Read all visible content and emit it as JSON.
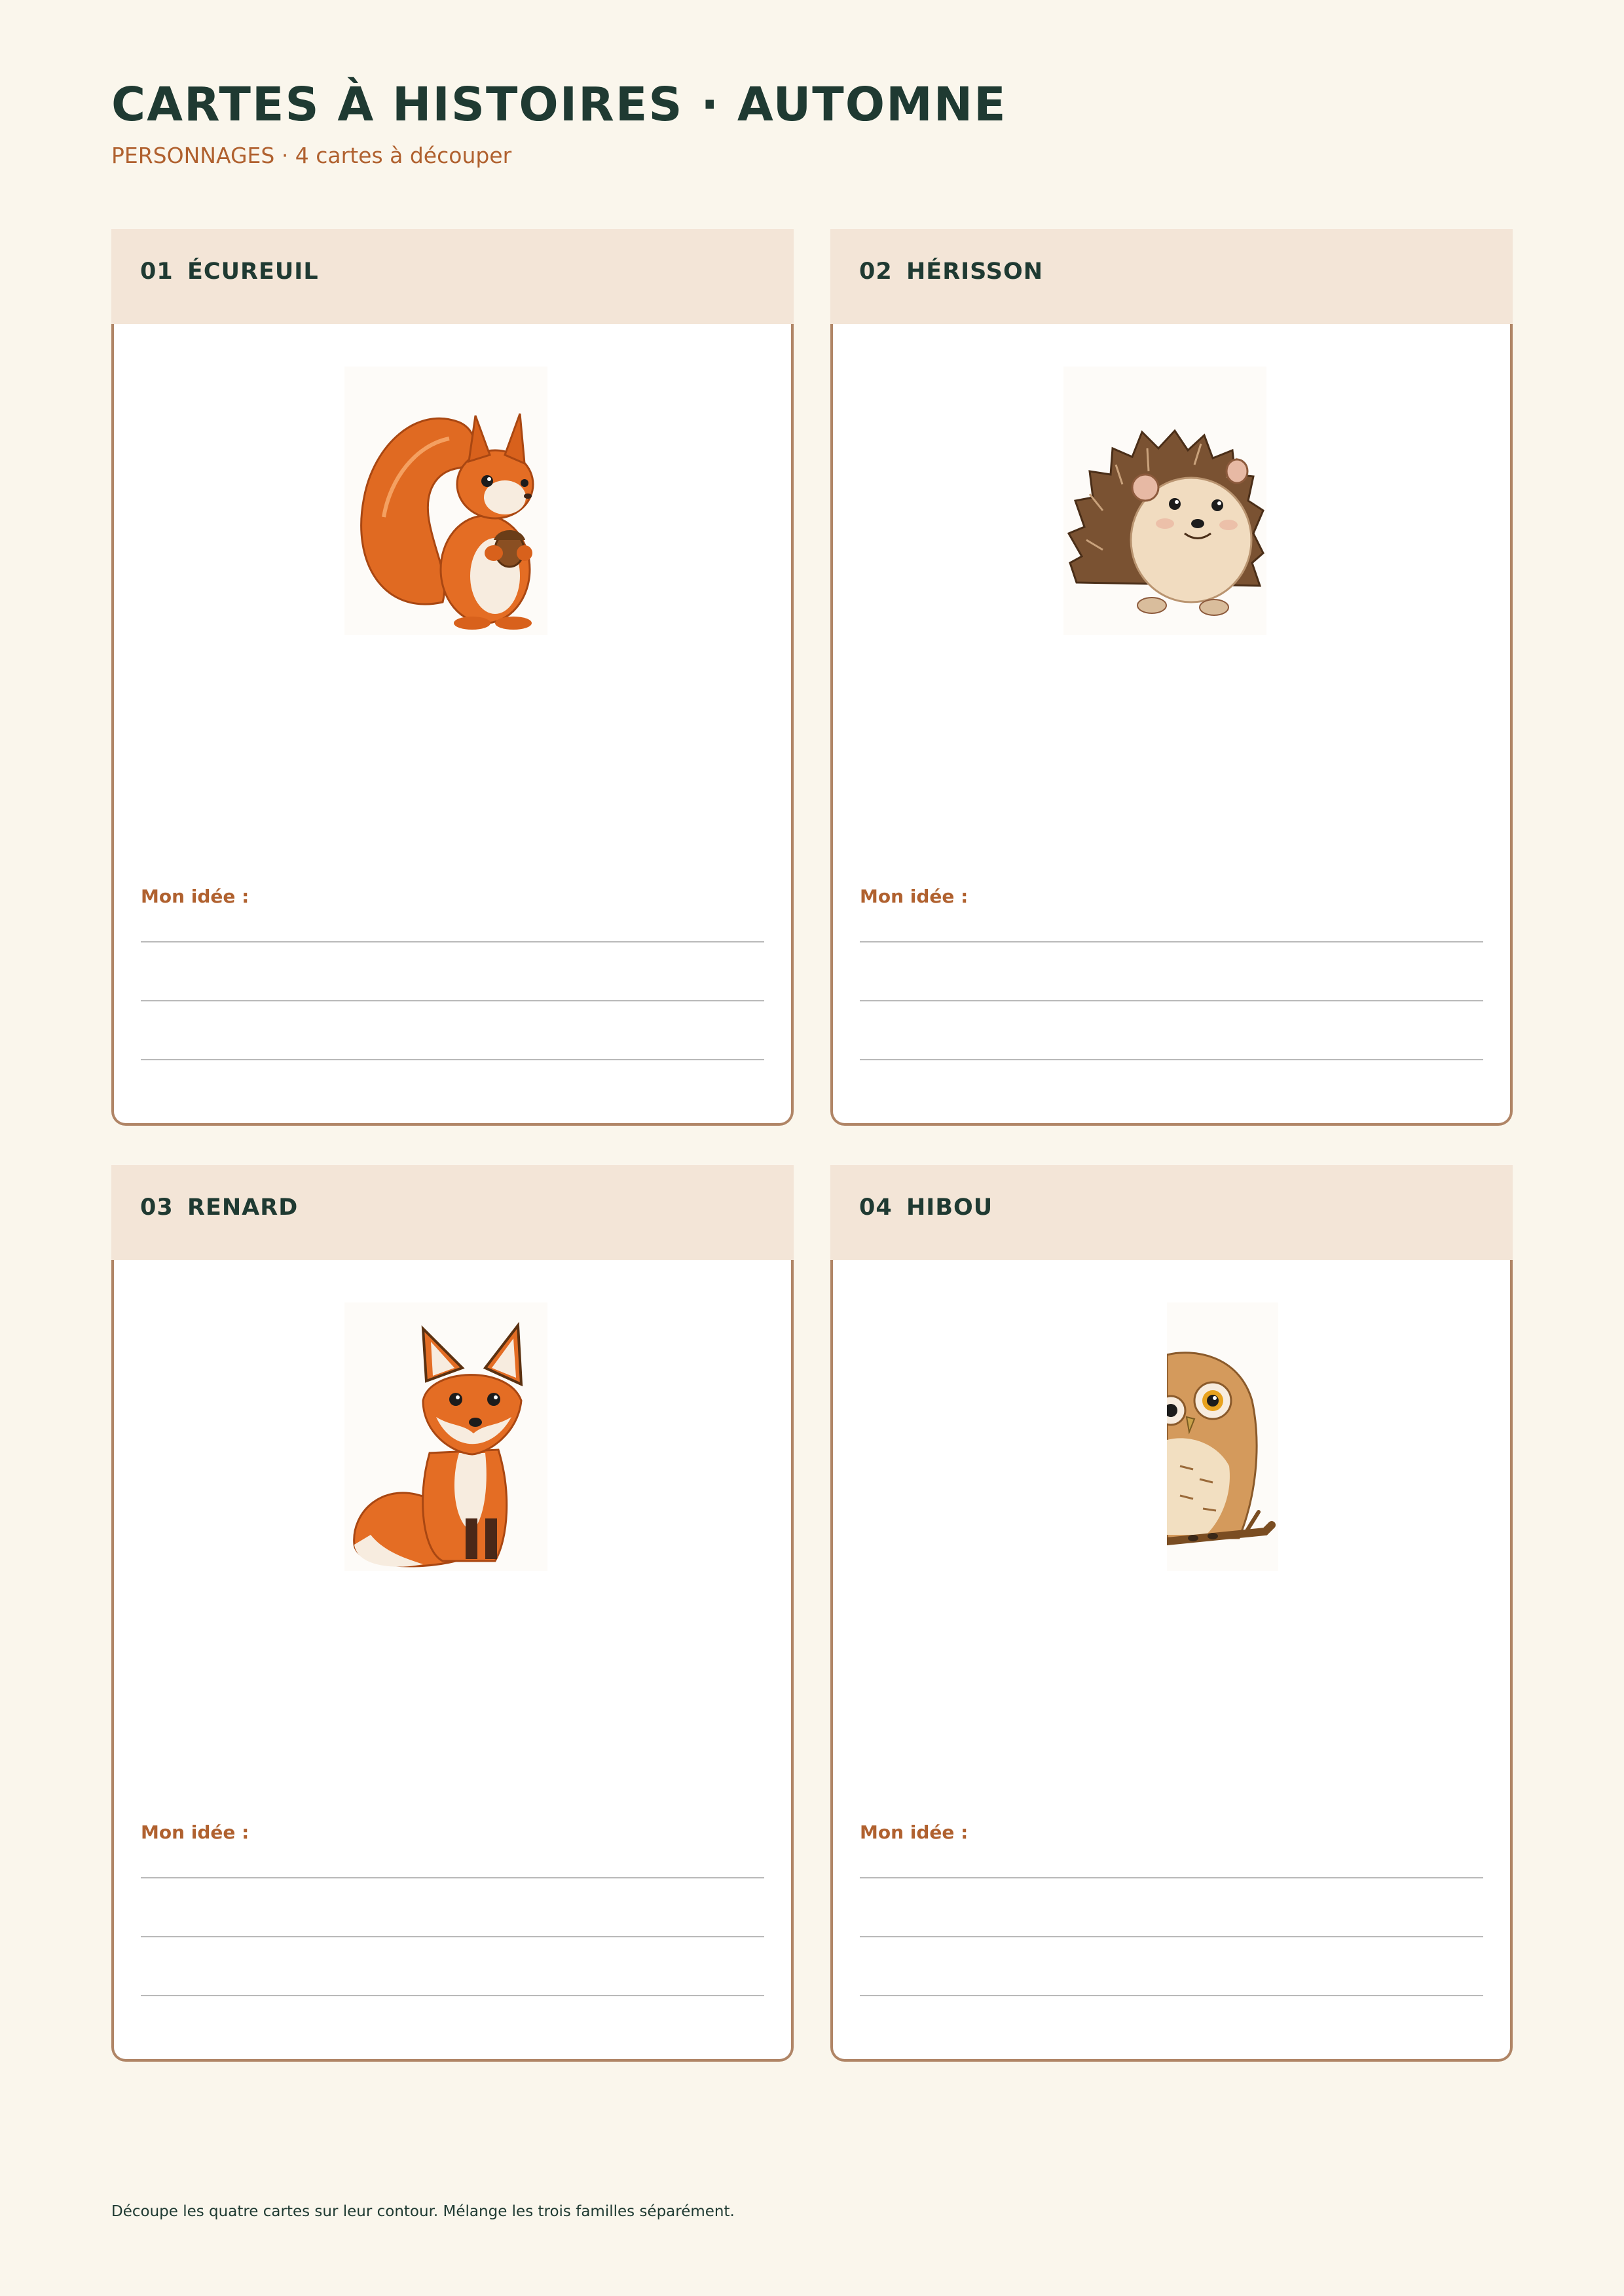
{
  "header": {
    "title": "CARTES À HISTOIRES · AUTOMNE",
    "subtitle": "PERSONNAGES · 4 cartes à découper"
  },
  "cards": [
    {
      "number": "01",
      "name": "ÉCUREUIL",
      "icon": "squirrel-icon",
      "idea_label": "Mon idée :"
    },
    {
      "number": "02",
      "name": "HÉRISSON",
      "icon": "hedgehog-icon",
      "idea_label": "Mon idée :"
    },
    {
      "number": "03",
      "name": "RENARD",
      "icon": "fox-icon",
      "idea_label": "Mon idée :"
    },
    {
      "number": "04",
      "name": "HIBOU",
      "icon": "owl-icon",
      "idea_label": "Mon idée :"
    }
  ],
  "footer": {
    "text": "Découpe les quatre cartes sur leur contour. Mélange les trois familles séparément."
  },
  "colors": {
    "background": "#faf6ec",
    "card_header": "#f3e5d7",
    "card_border": "#b08566",
    "title": "#1f3a32",
    "accent": "#b0612f"
  }
}
